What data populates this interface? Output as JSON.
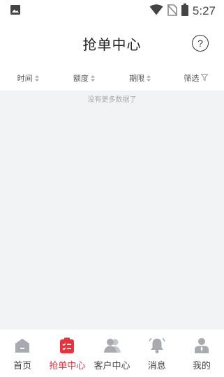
{
  "status_bar": {
    "time": "5:27",
    "icons": [
      "image-icon",
      "wifi-icon",
      "no-sim-icon",
      "battery-icon"
    ]
  },
  "header": {
    "title": "抢单中心",
    "help_icon": "question-circle-icon",
    "help_label": "?"
  },
  "filters": [
    {
      "label": "时间",
      "icon": "sort-arrows-icon"
    },
    {
      "label": "额度",
      "icon": "sort-arrows-icon"
    },
    {
      "label": "期限",
      "icon": "sort-arrows-icon"
    },
    {
      "label": "筛选",
      "icon": "filter-funnel-icon"
    }
  ],
  "content": {
    "empty_text": "没有更多数据了"
  },
  "tab_bar": {
    "active_color": "#e8313a",
    "inactive_color": "#a7abb0",
    "tabs": [
      {
        "label": "首页",
        "icon": "home-icon",
        "active": false
      },
      {
        "label": "抢单中心",
        "icon": "grab-order-icon",
        "active": true
      },
      {
        "label": "客户中心",
        "icon": "customers-icon",
        "active": false
      },
      {
        "label": "消息",
        "icon": "bell-icon",
        "active": false
      },
      {
        "label": "我的",
        "icon": "profile-icon",
        "active": false
      }
    ]
  }
}
